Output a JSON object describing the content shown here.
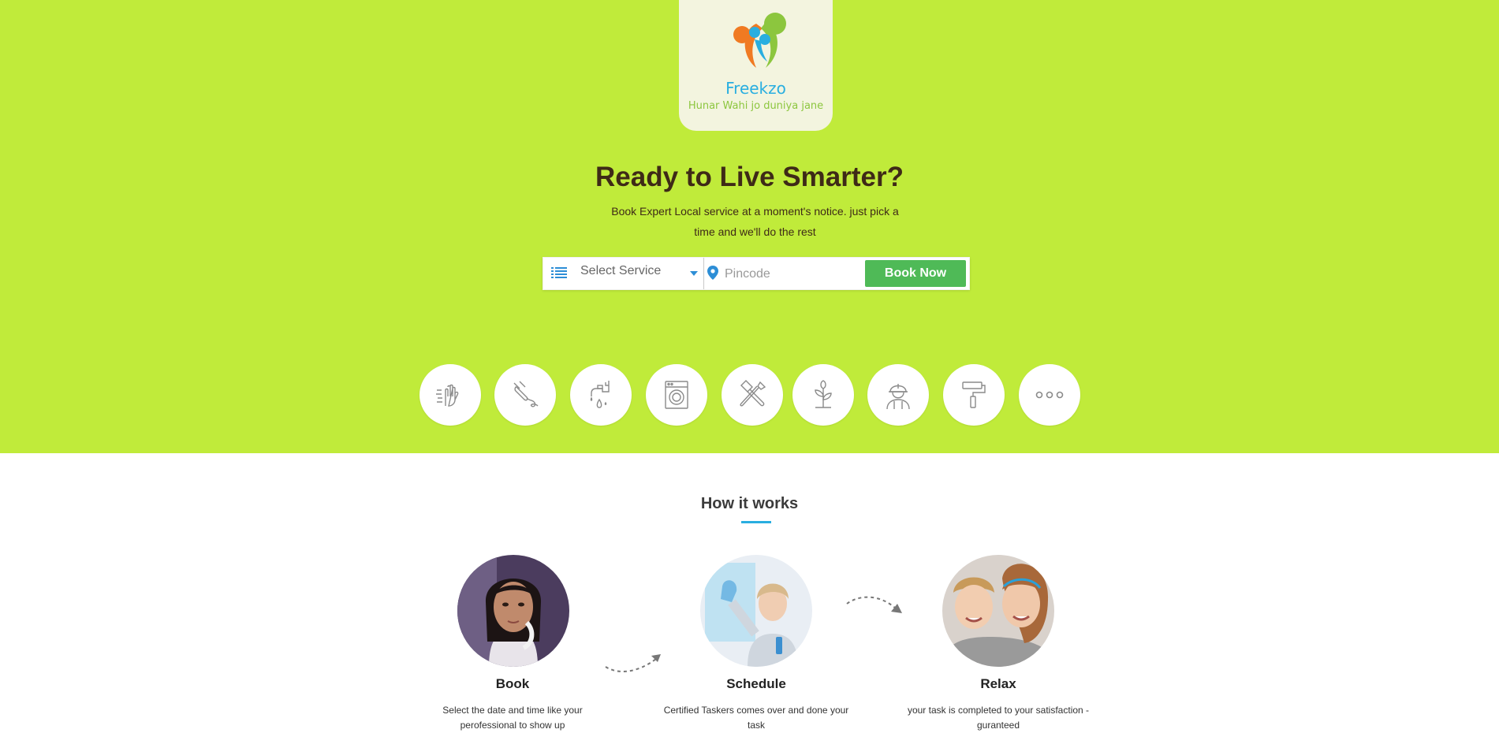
{
  "brand": {
    "name": "Freekzo",
    "tagline": "Hunar Wahi jo duniya jane",
    "colors": {
      "hero_bg": "#c0eb3a",
      "primary_blue": "#29aee0",
      "green_button": "#4fba57",
      "heading": "#3e2a17"
    }
  },
  "hero": {
    "headline": "Ready to Live Smarter?",
    "subheadline": "Book Expert Local service at a moment's notice. just pick a time and we'll do the rest"
  },
  "search": {
    "service_placeholder": "Select Service",
    "pincode_placeholder": "Pincode",
    "book_button": "Book Now"
  },
  "services": [
    {
      "icon": "cleaning-hands-icon"
    },
    {
      "icon": "electric-plug-icon"
    },
    {
      "icon": "plumbing-tap-icon"
    },
    {
      "icon": "washing-machine-icon"
    },
    {
      "icon": "carpentry-tools-icon"
    },
    {
      "icon": "gardening-plant-icon"
    },
    {
      "icon": "worker-helmet-icon"
    },
    {
      "icon": "paint-roller-icon"
    },
    {
      "icon": "more-dots-icon"
    }
  ],
  "how_it_works": {
    "title": "How it works",
    "steps": [
      {
        "title": "Book",
        "description": "Select the date and time like your perofessional to show up",
        "image": "woman-on-phone-photo"
      },
      {
        "title": "Schedule",
        "description": "Certified Taskers comes over and done your task",
        "image": "cleaner-wiping-glass-photo"
      },
      {
        "title": "Relax",
        "description": "your task is completed to your satisfaction - guranteed",
        "image": "smiling-children-photo"
      }
    ]
  }
}
